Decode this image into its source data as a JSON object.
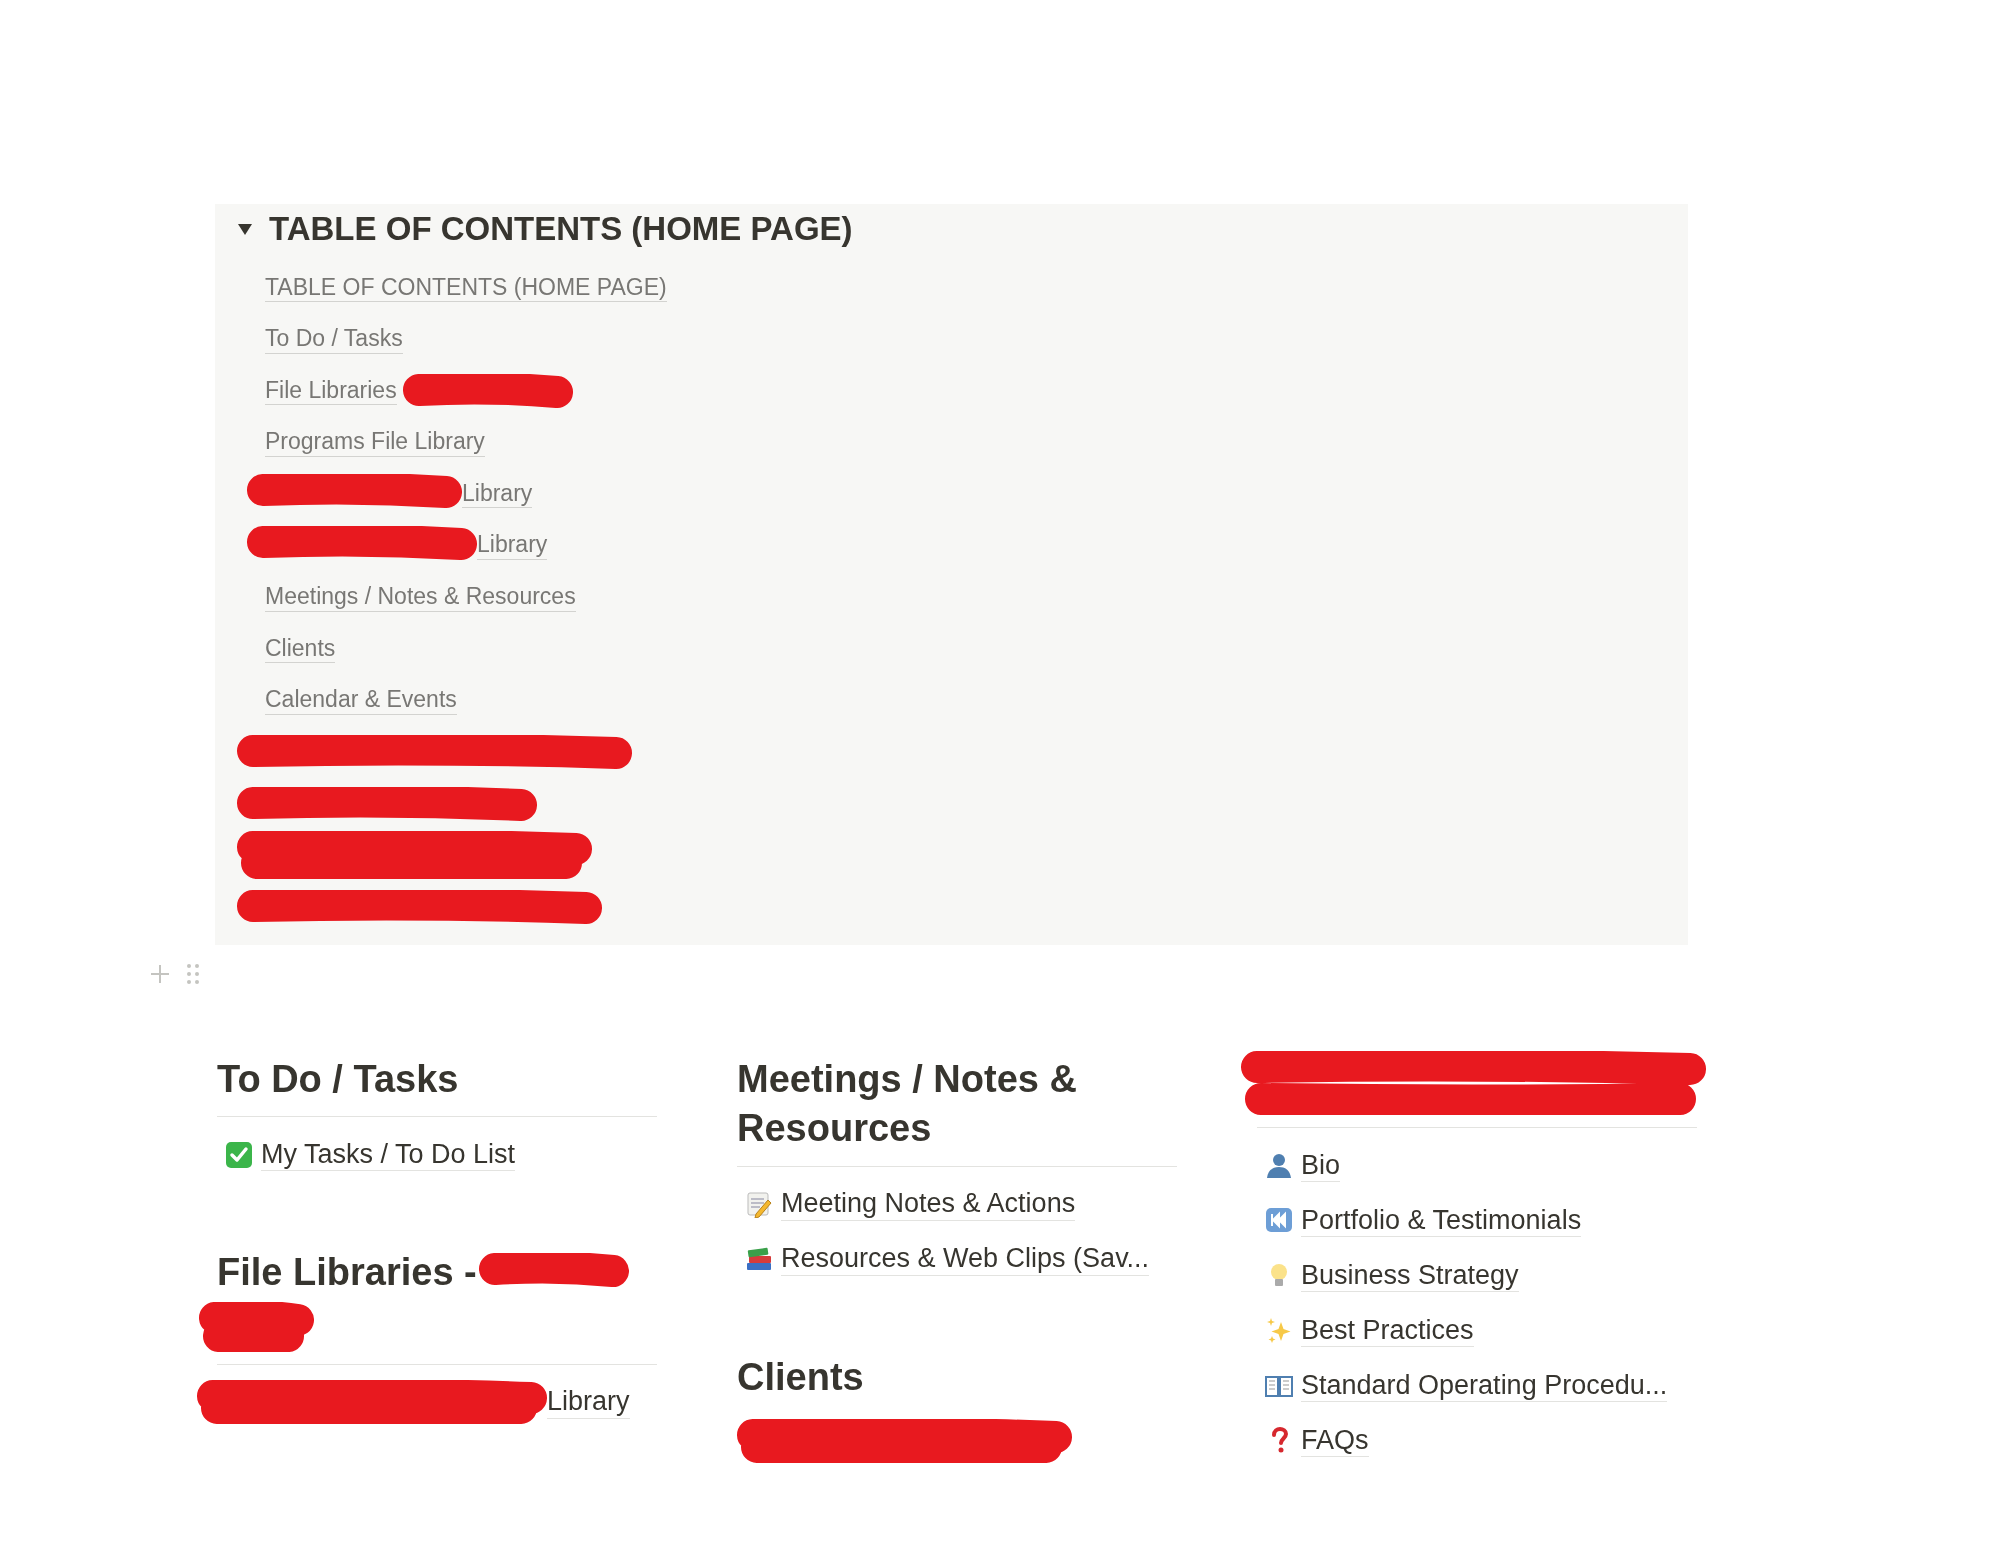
{
  "toggle": {
    "title": "TABLE OF CONTENTS (HOME PAGE)",
    "expanded": true,
    "links": [
      {
        "kind": "link",
        "text": "TABLE OF CONTENTS (HOME PAGE)"
      },
      {
        "kind": "link",
        "text": "To Do / Tasks"
      },
      {
        "kind": "redacted_suffix",
        "text": "File Libraries"
      },
      {
        "kind": "link",
        "text": "Programs File Library"
      },
      {
        "kind": "redacted_prefix",
        "text": "Library"
      },
      {
        "kind": "redacted_prefix",
        "text": "Library"
      },
      {
        "kind": "link",
        "text": "Meetings / Notes & Resources"
      },
      {
        "kind": "link",
        "text": "Clients"
      },
      {
        "kind": "link",
        "text": "Calendar & Events"
      },
      {
        "kind": "redacted"
      },
      {
        "kind": "redacted"
      },
      {
        "kind": "redacted"
      },
      {
        "kind": "redacted"
      }
    ]
  },
  "columns": [
    {
      "sections": [
        {
          "kind": "text",
          "heading": "To Do / Tasks",
          "items": [
            {
              "kind": "check",
              "text": "My Tasks / To Do List"
            }
          ]
        },
        {
          "kind": "redacted_suffix",
          "heading": "File Libraries -",
          "items": [
            {
              "kind": "redacted_prefix",
              "text": "Library"
            }
          ]
        }
      ]
    },
    {
      "sections": [
        {
          "kind": "text",
          "heading": "Meetings / Notes & Resources",
          "items": [
            {
              "kind": "notes",
              "text": "Meeting Notes & Actions"
            },
            {
              "kind": "books",
              "text": "Resources & Web Clips (Sav..."
            }
          ]
        },
        {
          "kind": "plain",
          "heading": "Clients",
          "items": [
            {
              "kind": "redacted"
            }
          ]
        }
      ]
    },
    {
      "sections": [
        {
          "kind": "redacted",
          "items": [
            {
              "kind": "person",
              "text": "Bio"
            },
            {
              "kind": "rewind",
              "text": "Portfolio & Testimonials"
            },
            {
              "kind": "bulb",
              "text": "Business Strategy"
            },
            {
              "kind": "sparkles",
              "text": "Best Practices"
            },
            {
              "kind": "book",
              "text": "Standard Operating Procedu..."
            },
            {
              "kind": "question",
              "text": "FAQs"
            }
          ]
        }
      ]
    }
  ]
}
